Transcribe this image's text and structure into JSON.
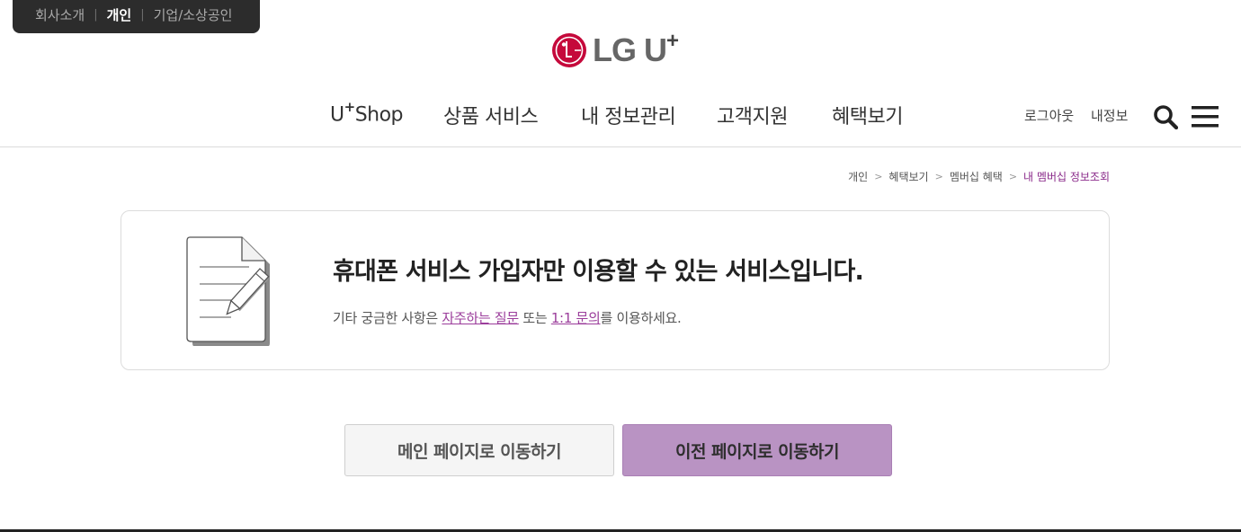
{
  "segment_tabs": {
    "items": [
      {
        "label": "회사소개",
        "active": false
      },
      {
        "label": "개인",
        "active": true
      },
      {
        "label": "기업/소상공인",
        "active": false
      }
    ],
    "separator": "|"
  },
  "logo": {
    "text": "LG U",
    "sup": "+"
  },
  "gnb": {
    "ushop": {
      "main": "U",
      "sup": "+",
      "rest": "Shop"
    },
    "items": [
      "상품 서비스",
      "내 정보관리",
      "고객지원",
      "혜택보기"
    ]
  },
  "util": {
    "logout": "로그아웃",
    "myinfo": "내정보"
  },
  "breadcrumb": {
    "items": [
      "개인",
      "혜택보기",
      "멤버십 혜택",
      "내 멤버십 정보조회"
    ],
    "arrow": ">"
  },
  "notice": {
    "title": "휴대폰 서비스 가입자만 이용할 수 있는 서비스입니다.",
    "desc_prefix": "기타 궁금한 사항은 ",
    "faq_link": "자주하는 질문",
    "desc_mid": " 또는 ",
    "qna_link": "1:1 문의",
    "desc_suffix": "를 이용하세요."
  },
  "buttons": {
    "main_page": "메인 페이지로 이동하기",
    "prev_page": "이전 페이지로 이동하기"
  },
  "colors": {
    "brand_magenta": "#e6007e",
    "link_purple": "#9b3d9b",
    "primary_button": "#b993c3",
    "segment_bg": "#2c2c2c"
  }
}
